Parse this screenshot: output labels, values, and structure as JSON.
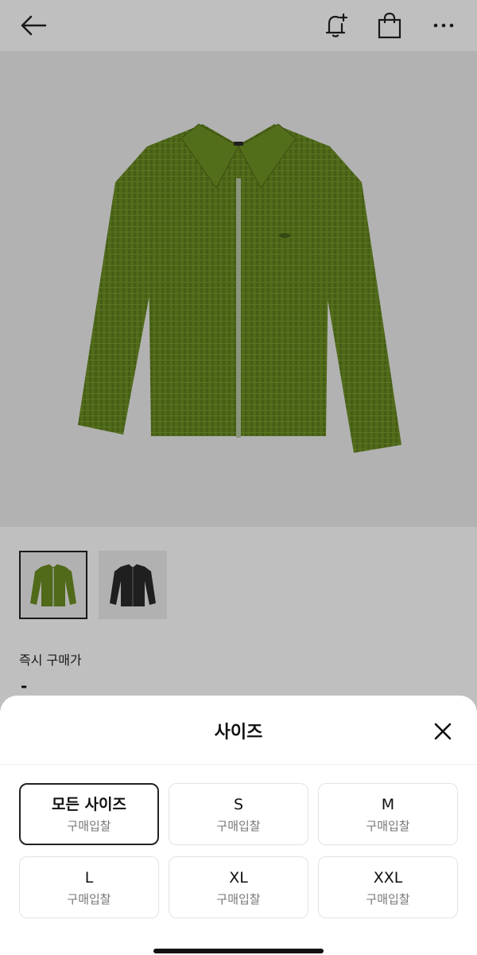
{
  "header": {
    "back_icon": "arrow-left-icon",
    "alert_icon": "bell-plus-icon",
    "bag_icon": "shopping-bag-icon",
    "more_icon": "more-horizontal-icon"
  },
  "product": {
    "main_color": "#6b8e23",
    "thumbnails": [
      {
        "color": "#6b8e23",
        "selected": true
      },
      {
        "color": "#2a2a2a",
        "selected": false
      }
    ],
    "instant_buy_label": "즉시 구매가",
    "instant_buy_value": "-"
  },
  "size_sheet": {
    "title": "사이즈",
    "close_icon": "close-icon",
    "options": [
      {
        "size": "모든 사이즈",
        "action": "구매입찰",
        "selected": true
      },
      {
        "size": "S",
        "action": "구매입찰",
        "selected": false
      },
      {
        "size": "M",
        "action": "구매입찰",
        "selected": false
      },
      {
        "size": "L",
        "action": "구매입찰",
        "selected": false
      },
      {
        "size": "XL",
        "action": "구매입찰",
        "selected": false
      },
      {
        "size": "XXL",
        "action": "구매입찰",
        "selected": false
      }
    ]
  }
}
